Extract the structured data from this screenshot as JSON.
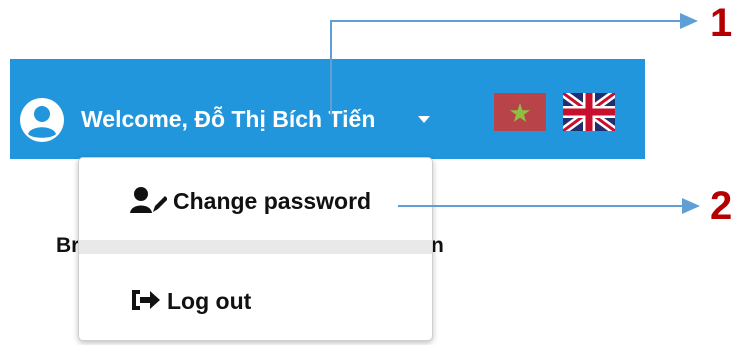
{
  "header": {
    "welcome_text": "Welcome, Đỗ Thị Bích Tiến",
    "accent_color": "#2196dc",
    "languages": [
      "vn-flag",
      "uk-flag"
    ]
  },
  "background": {
    "left_fragment": "Br",
    "right_fragment": "n"
  },
  "menu": {
    "items": [
      {
        "label": "Change password",
        "icon": "user-edit-icon"
      },
      {
        "label": "Log out",
        "icon": "sign-out-icon"
      }
    ]
  },
  "annotations": [
    {
      "number": "1",
      "color": "#b40000"
    },
    {
      "number": "2",
      "color": "#b40000"
    }
  ]
}
